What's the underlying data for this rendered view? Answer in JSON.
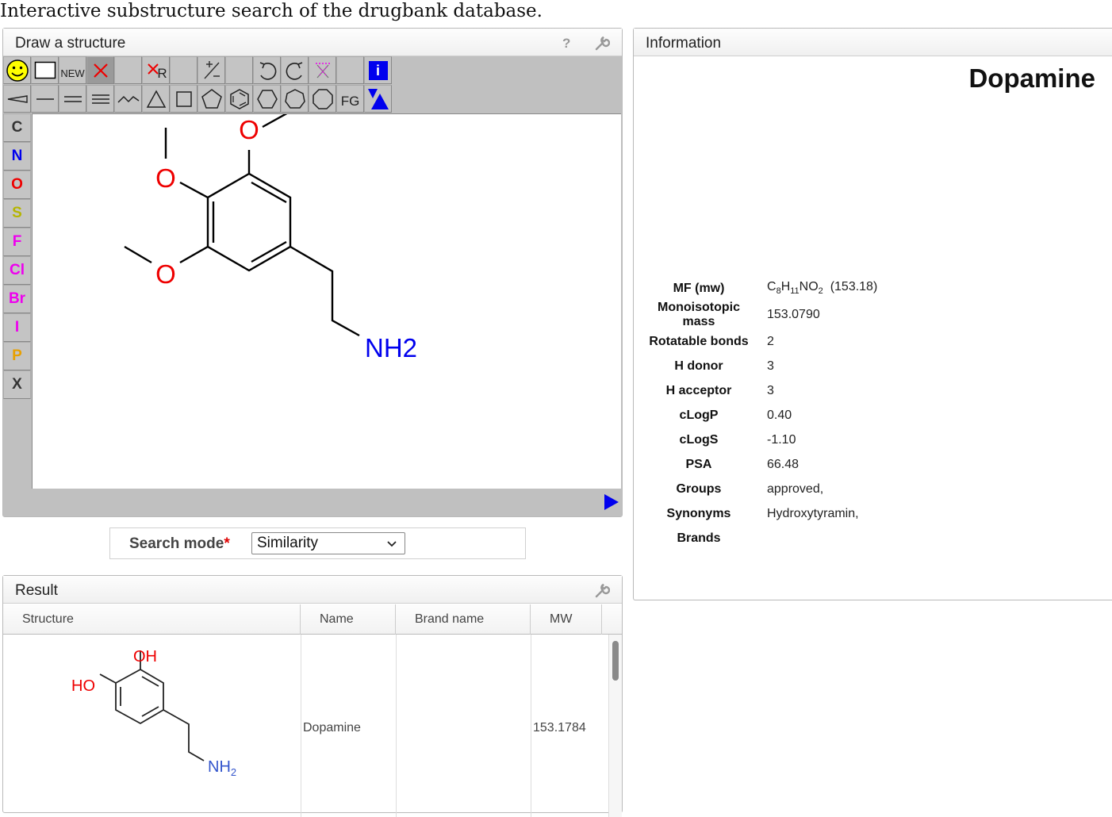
{
  "page": {
    "title": "Interactive substructure search of the drugbank database."
  },
  "draw_panel": {
    "title": "Draw a structure",
    "icons": [
      "help-icon",
      "wrench-icon"
    ],
    "help_glyph": "?",
    "toolbar_row1": [
      "smiley",
      "rect",
      "NEW",
      "delete-x",
      "",
      "R",
      "",
      "+/-",
      "",
      "undo",
      "redo",
      "clear",
      "",
      "info"
    ],
    "new_label": "NEW",
    "r_label": "R",
    "fg_label": "FG",
    "info_label": "i",
    "atoms": [
      {
        "label": "C",
        "color": "#333333"
      },
      {
        "label": "N",
        "color": "#0000ee"
      },
      {
        "label": "O",
        "color": "#ee0000"
      },
      {
        "label": "S",
        "color": "#b5b500"
      },
      {
        "label": "F",
        "color": "#ee00ee"
      },
      {
        "label": "Cl",
        "color": "#ee00ee"
      },
      {
        "label": "Br",
        "color": "#ee00ee"
      },
      {
        "label": "I",
        "color": "#ee00ee"
      },
      {
        "label": "P",
        "color": "#e8a000"
      },
      {
        "label": "X",
        "color": "#333333"
      }
    ],
    "molecule_labels": {
      "o1": "O",
      "o2": "O",
      "o3": "O",
      "amine": "NH2"
    }
  },
  "info_panel": {
    "title": "Information",
    "molecule_name": "Dopamine",
    "properties": [
      {
        "key": "MF (mw)",
        "value": "(153.18)"
      },
      {
        "key": "Monoisotopic mass",
        "value": "153.0790"
      },
      {
        "key": "Rotatable bonds",
        "value": "2"
      },
      {
        "key": "H donor",
        "value": "3"
      },
      {
        "key": "H acceptor",
        "value": "3"
      },
      {
        "key": "cLogP",
        "value": "0.40"
      },
      {
        "key": "cLogS",
        "value": "-1.10"
      },
      {
        "key": "PSA",
        "value": "66.48"
      },
      {
        "key": "Groups",
        "value": "approved,"
      },
      {
        "key": "Synonyms",
        "value": "Hydroxytyramin,"
      },
      {
        "key": "Brands",
        "value": ""
      }
    ],
    "formula": {
      "c": "C",
      "c_n": "8",
      "h": "H",
      "h_n": "11",
      "rest": "NO",
      "o_n": "2"
    }
  },
  "search": {
    "label": "Search mode",
    "required_mark": "*",
    "selected": "Similarity"
  },
  "result_panel": {
    "title": "Result",
    "columns": [
      "Structure",
      "Name",
      "Brand name",
      "MW"
    ],
    "rows": [
      {
        "name": "Dopamine",
        "brand": "",
        "mw": "153.1784",
        "labels": {
          "oh": "OH",
          "ho": "HO",
          "nh": "NH",
          "nh_sub": "2"
        }
      }
    ]
  },
  "colors": {
    "nitrogen": "#0000ee",
    "oxygen": "#ee0000",
    "toolbar": "#c4c4c4"
  }
}
